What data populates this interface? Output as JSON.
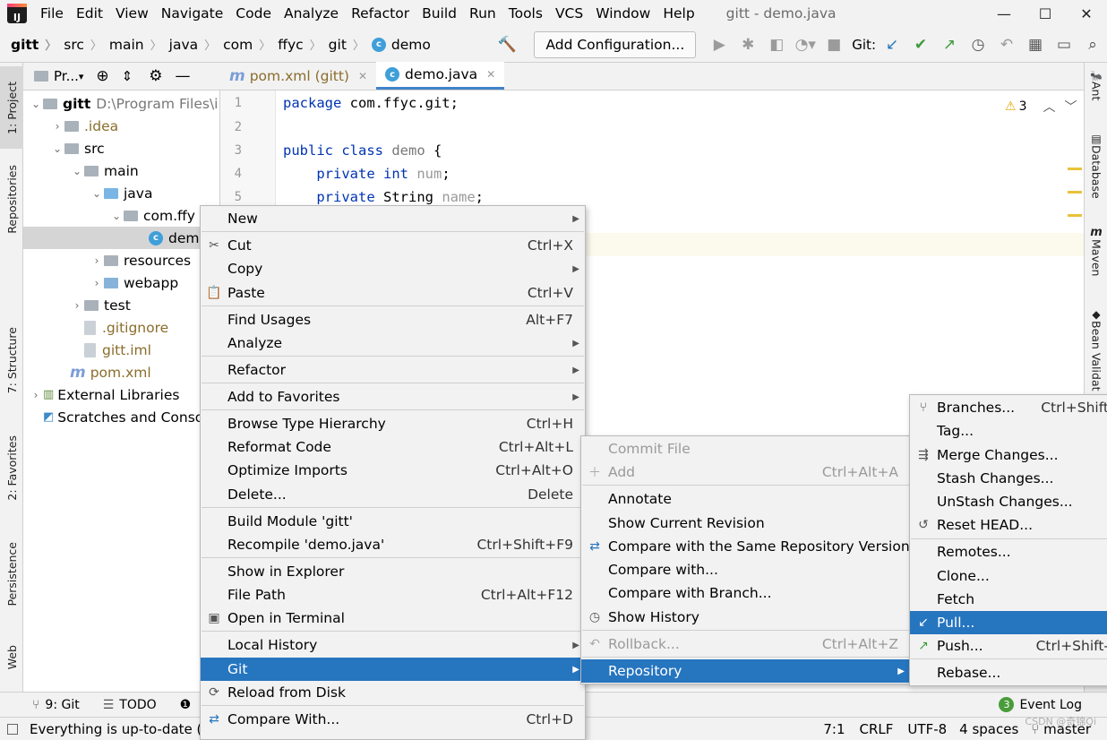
{
  "menubar": {
    "logo": "IJ",
    "items": [
      "File",
      "Edit",
      "View",
      "Navigate",
      "Code",
      "Analyze",
      "Refactor",
      "Build",
      "Run",
      "Tools",
      "VCS",
      "Window",
      "Help"
    ],
    "title": "gitt - demo.java"
  },
  "navbar": {
    "crumbs": [
      "gitt",
      "src",
      "main",
      "java",
      "com",
      "ffyc",
      "git",
      "demo"
    ],
    "add_config": "Add Configuration...",
    "git_label": "Git:"
  },
  "left_tabs": {
    "project": "1: Project",
    "repositories": "Repositories",
    "structure": "7: Structure",
    "favorites": "2: Favorites",
    "persistence": "Persistence",
    "web": "Web"
  },
  "right_tabs": {
    "ant": "Ant",
    "database": "Database",
    "maven": "Maven",
    "bean": "Bean Validat"
  },
  "project": {
    "header": "Pr...",
    "root_name": "gitt",
    "root_path": "D:\\Program Files\\i",
    "nodes": [
      ".idea",
      "src",
      "main",
      "java",
      "com.ffy",
      "dem",
      "resources",
      "webapp",
      "test",
      ".gitignore",
      "gitt.iml",
      "pom.xml",
      "External Libraries",
      "Scratches and Conso"
    ]
  },
  "editor": {
    "tabs": [
      "pom.xml (gitt)",
      "demo.java"
    ],
    "warnings": "3",
    "line_numbers": [
      "1",
      "2",
      "3",
      "4",
      "5"
    ],
    "code": {
      "l1_kw": "package",
      "l1_rest": " com.ffyc.git;",
      "l3_kw": "public class",
      "l3_name": "demo",
      "l3_brace": " {",
      "l4_kw": "private",
      "l4_type": "int",
      "l4_field": "num",
      "l5_kw": "private",
      "l5_type": "String",
      "l5_field": "name"
    }
  },
  "context_menu": {
    "items": [
      {
        "label": "New",
        "shortcut": "",
        "sub": true
      },
      {
        "label": "Cut",
        "shortcut": "Ctrl+X",
        "icon": "cut-icon"
      },
      {
        "label": "Copy",
        "shortcut": "",
        "sub": true
      },
      {
        "label": "Paste",
        "shortcut": "Ctrl+V",
        "icon": "paste-icon"
      },
      {
        "label": "Find Usages",
        "shortcut": "Alt+F7"
      },
      {
        "label": "Analyze",
        "shortcut": "",
        "sub": true
      },
      {
        "label": "Refactor",
        "shortcut": "",
        "sub": true
      },
      {
        "label": "Add to Favorites",
        "shortcut": "",
        "sub": true
      },
      {
        "label": "Browse Type Hierarchy",
        "shortcut": "Ctrl+H"
      },
      {
        "label": "Reformat Code",
        "shortcut": "Ctrl+Alt+L"
      },
      {
        "label": "Optimize Imports",
        "shortcut": "Ctrl+Alt+O"
      },
      {
        "label": "Delete...",
        "shortcut": "Delete"
      },
      {
        "label": "Build Module 'gitt'",
        "shortcut": ""
      },
      {
        "label": "Recompile 'demo.java'",
        "shortcut": "Ctrl+Shift+F9"
      },
      {
        "label": "Show in Explorer",
        "shortcut": ""
      },
      {
        "label": "File Path",
        "shortcut": "Ctrl+Alt+F12"
      },
      {
        "label": "Open in Terminal",
        "shortcut": "",
        "icon": "terminal-icon"
      },
      {
        "label": "Local History",
        "shortcut": "",
        "sub": true
      },
      {
        "label": "Git",
        "shortcut": "",
        "sub": true,
        "selected": true
      },
      {
        "label": "Reload from Disk",
        "shortcut": "",
        "icon": "reload-icon"
      },
      {
        "label": "Compare With...",
        "shortcut": "Ctrl+D",
        "icon": "compare-icon"
      }
    ]
  },
  "git_menu": {
    "items": [
      {
        "label": "Commit File",
        "shortcut": "",
        "disabled": true
      },
      {
        "label": "Add",
        "shortcut": "Ctrl+Alt+A",
        "disabled": true,
        "icon": "plus-icon"
      },
      {
        "label": "Annotate",
        "shortcut": ""
      },
      {
        "label": "Show Current Revision",
        "shortcut": ""
      },
      {
        "label": "Compare with the Same Repository Version",
        "shortcut": "",
        "icon": "compare-icon"
      },
      {
        "label": "Compare with...",
        "shortcut": ""
      },
      {
        "label": "Compare with Branch...",
        "shortcut": ""
      },
      {
        "label": "Show History",
        "shortcut": "",
        "icon": "clock-icon"
      },
      {
        "label": "Rollback...",
        "shortcut": "Ctrl+Alt+Z",
        "disabled": true,
        "icon": "rollback-icon"
      },
      {
        "label": "Repository",
        "shortcut": "",
        "sub": true,
        "selected": true
      }
    ]
  },
  "repo_menu": {
    "items": [
      {
        "label": "Branches...",
        "shortcut": "Ctrl+Shift",
        "icon": "branch-icon"
      },
      {
        "label": "Tag...",
        "shortcut": ""
      },
      {
        "label": "Merge Changes...",
        "shortcut": "",
        "icon": "merge-icon"
      },
      {
        "label": "Stash Changes...",
        "shortcut": ""
      },
      {
        "label": "UnStash Changes...",
        "shortcut": ""
      },
      {
        "label": "Reset HEAD...",
        "shortcut": "",
        "icon": "reset-icon"
      },
      {
        "label": "Remotes...",
        "shortcut": ""
      },
      {
        "label": "Clone...",
        "shortcut": ""
      },
      {
        "label": "Fetch",
        "shortcut": ""
      },
      {
        "label": "Pull...",
        "shortcut": "",
        "selected": true,
        "icon": "pull-icon"
      },
      {
        "label": "Push...",
        "shortcut": "Ctrl+Shift-",
        "icon": "push-icon"
      },
      {
        "label": "Rebase...",
        "shortcut": ""
      }
    ]
  },
  "bottom_tabs": {
    "git": "9: Git",
    "todo": "TODO",
    "event_log": "Event Log",
    "event_count": "3"
  },
  "status": {
    "message": "Everything is up-to-date (6",
    "position": "7:1",
    "line_sep": "CRLF",
    "encoding": "UTF-8",
    "indent": "4 spaces",
    "branch": "master",
    "watermark": "CSDN @奇锦Qi"
  },
  "colors": {
    "accent": "#2675bf",
    "menubg": "#f2f2f2"
  }
}
